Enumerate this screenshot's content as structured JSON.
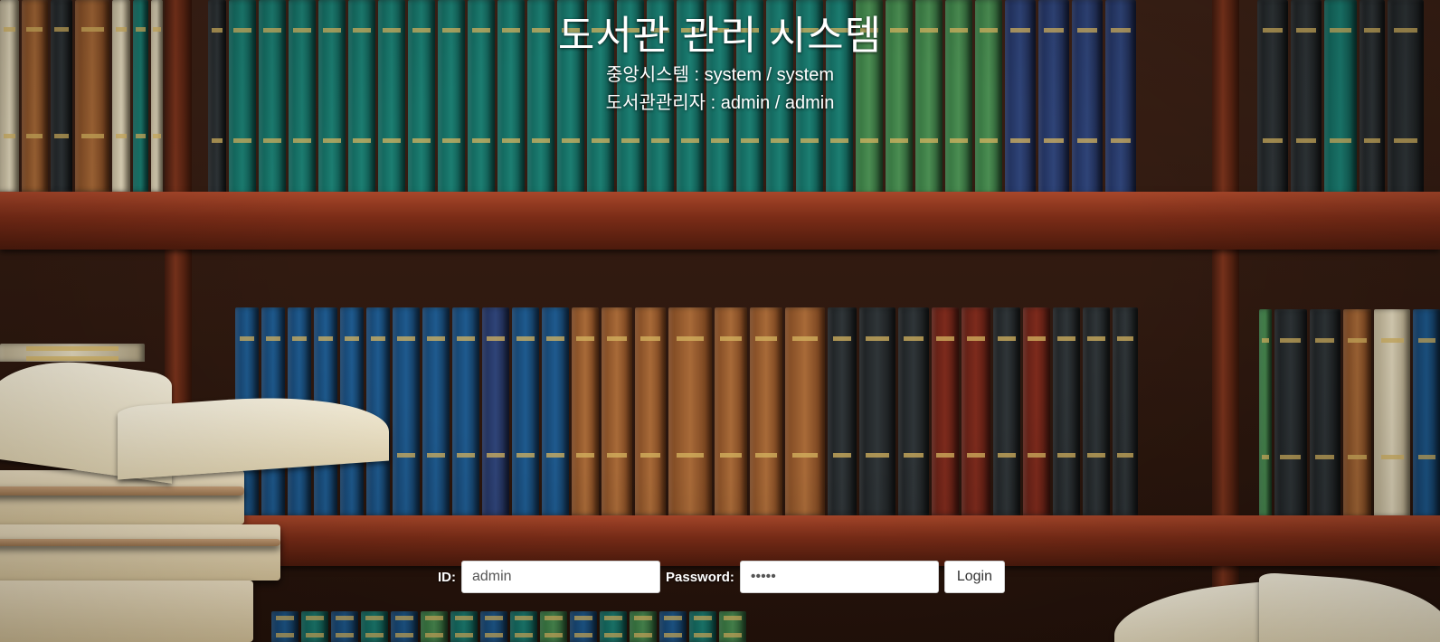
{
  "header": {
    "title": "도서관 관리 시스템",
    "central_account": "중앙시스템 : system / system",
    "librarian_account": "도서관관리자 : admin / admin"
  },
  "login": {
    "id_label": "ID:",
    "id_value": "admin",
    "password_label": "Password:",
    "password_value": "admin",
    "submit_label": "Login"
  },
  "colors": {
    "text": "#ffffff",
    "field_background": "#ffffff",
    "button_background": "#ffffff",
    "shelf_wood": "#7a2c17"
  },
  "background": {
    "image": "bookshelf-photo"
  }
}
